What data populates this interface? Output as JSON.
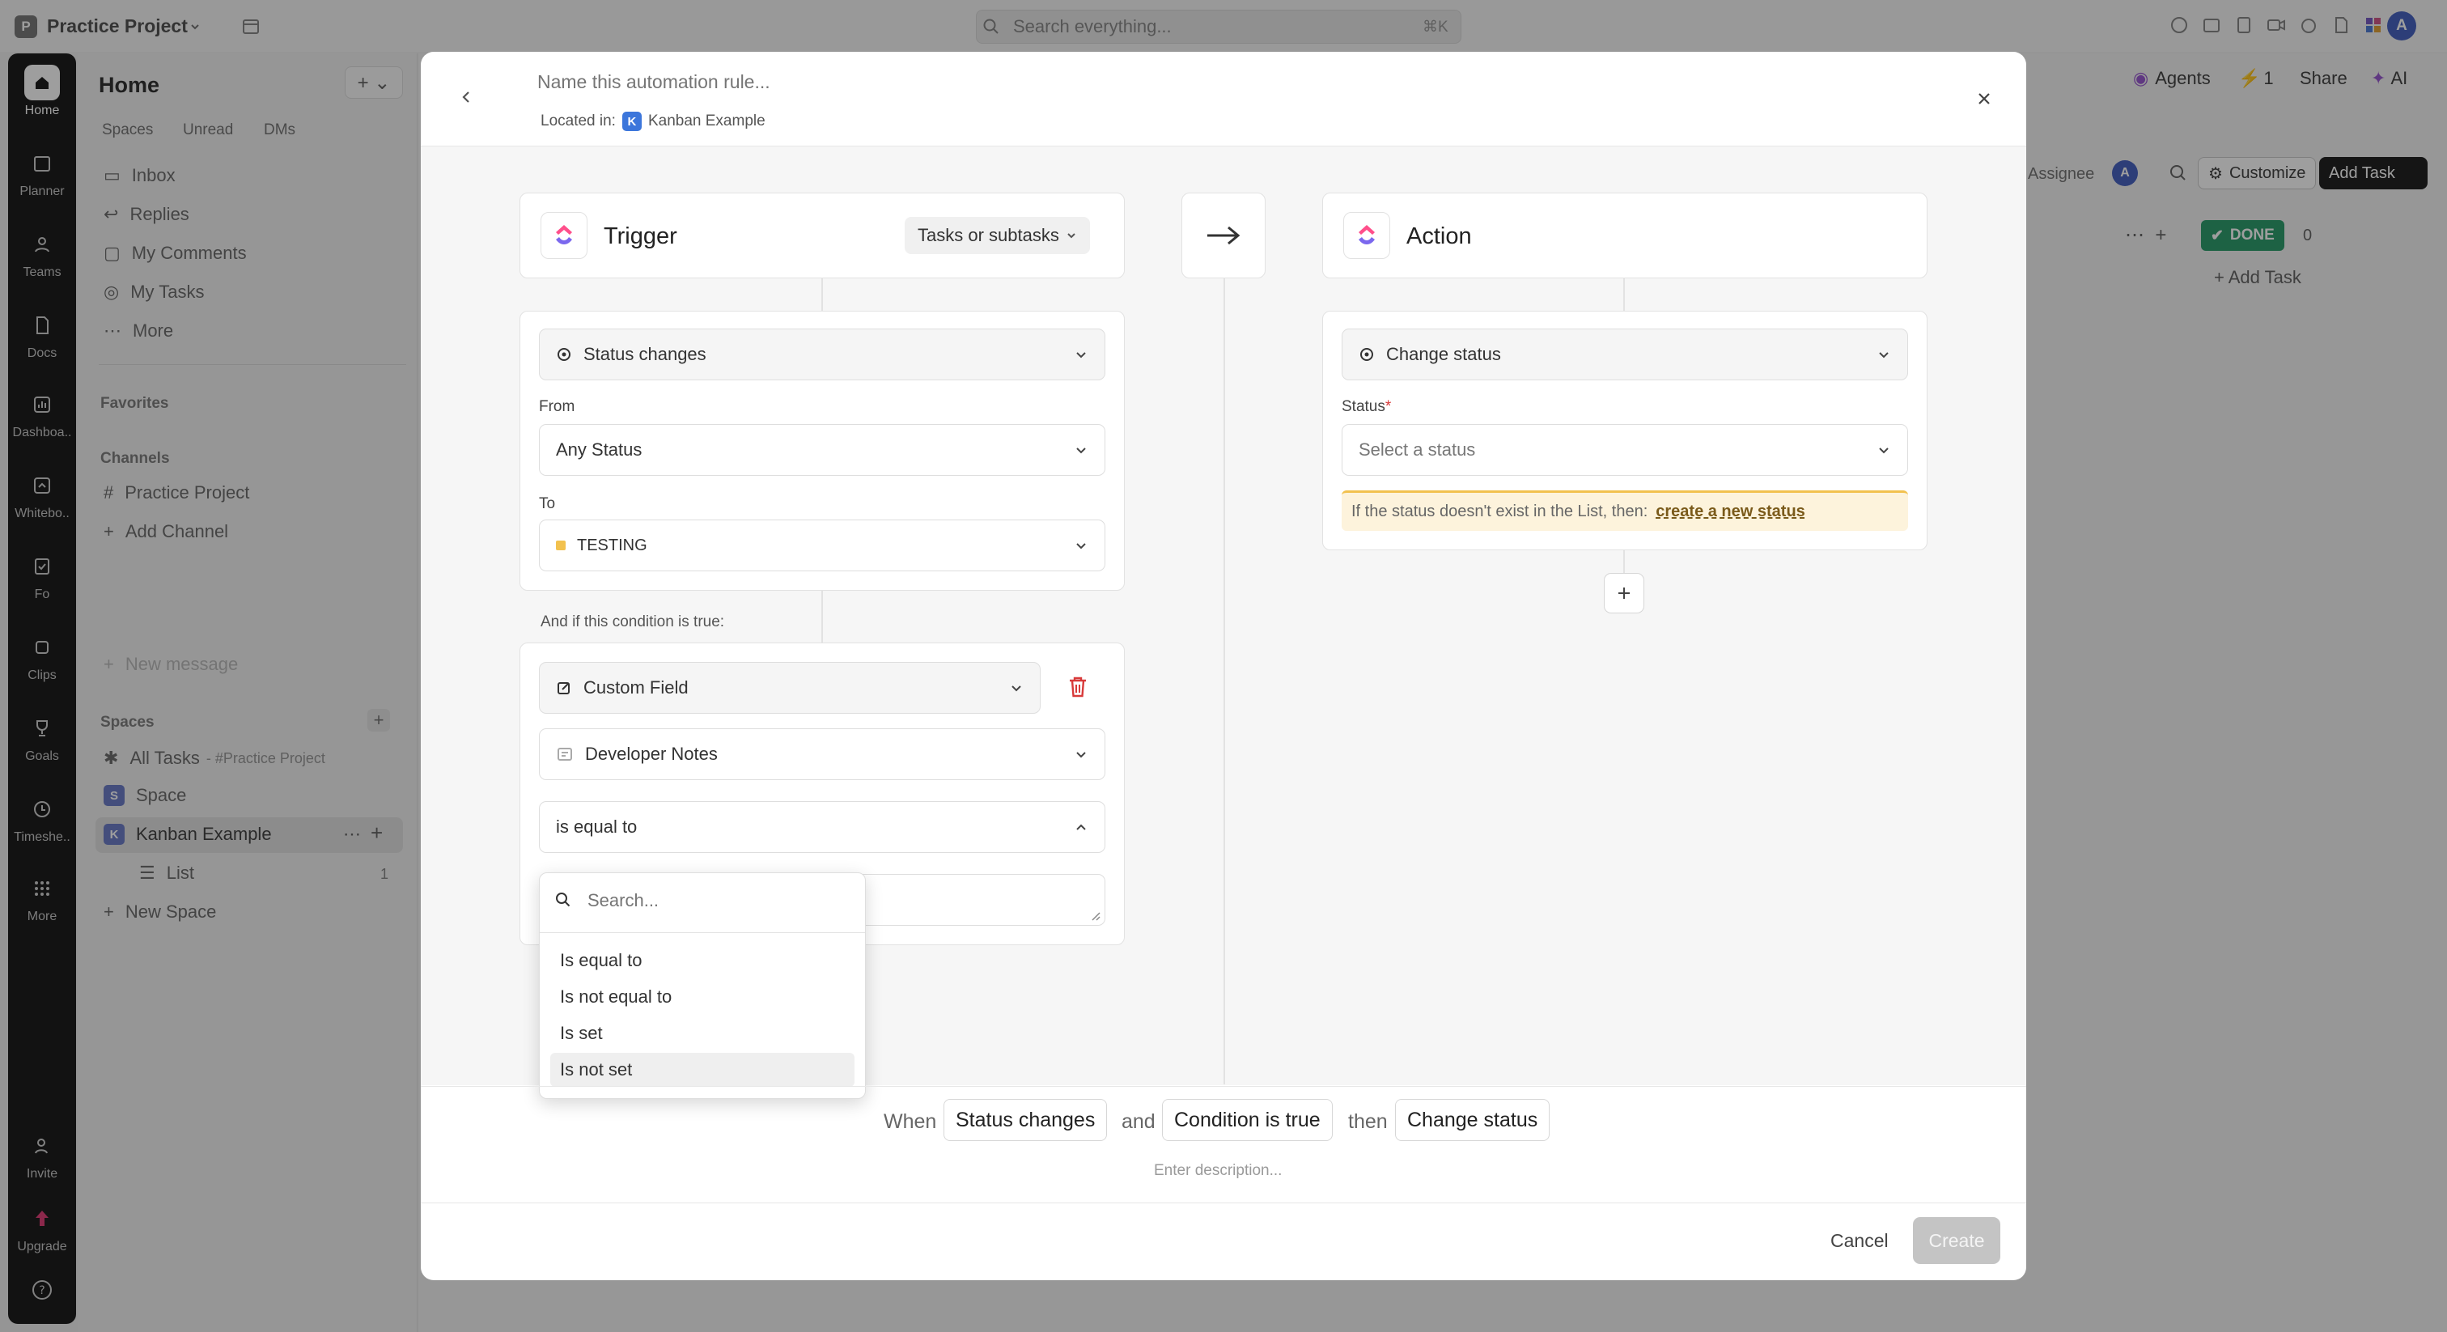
{
  "app": {
    "workspace_initial": "P",
    "workspace_name": "Practice Project",
    "search_placeholder": "Search everything...",
    "search_shortcut": "⌘K",
    "user_initial": "A"
  },
  "rail": {
    "items": [
      {
        "label": "Home",
        "icon": "home-icon"
      },
      {
        "label": "Planner",
        "icon": "calendar-icon"
      },
      {
        "label": "Teams",
        "icon": "teams-icon"
      },
      {
        "label": "Docs",
        "icon": "doc-icon"
      },
      {
        "label": "Dashboa..",
        "icon": "dashboard-icon"
      },
      {
        "label": "Whitebo..",
        "icon": "whiteboard-icon"
      },
      {
        "label": "Fo",
        "icon": "forms-icon"
      },
      {
        "label": "Clips",
        "icon": "clips-icon"
      },
      {
        "label": "Goals",
        "icon": "trophy-icon"
      },
      {
        "label": "Timeshe..",
        "icon": "clock-icon"
      },
      {
        "label": "More",
        "icon": "grid-icon"
      }
    ],
    "invite": "Invite",
    "upgrade": "Upgrade"
  },
  "sidebar": {
    "title": "Home",
    "tabs": [
      "Spaces",
      "Unread",
      "DMs"
    ],
    "nav": [
      "Inbox",
      "Replies",
      "My Comments",
      "My Tasks",
      "More"
    ],
    "favorites": "Favorites",
    "channels_label": "Channels",
    "channels": [
      "Practice Project"
    ],
    "add_channel": "Add Channel",
    "new_message": "New message",
    "spaces_label": "Spaces",
    "all_tasks": "All Tasks",
    "all_tasks_suffix": "- #Practice Project",
    "space": "Space",
    "space_initial": "S",
    "kanban": "Kanban Example",
    "kanban_initial": "K",
    "list": "List",
    "list_count": "1",
    "new_space": "New Space"
  },
  "background": {
    "agents": "Agents",
    "alerts": "1",
    "share": "Share",
    "ai": "AI",
    "assignee": "Assignee",
    "assignee_initial": "A",
    "customize": "Customize",
    "add_task_btn": "Add Task",
    "done_status": "DONE",
    "done_count": "0",
    "add_task_link": "+ Add Task"
  },
  "modal": {
    "name_placeholder": "Name this automation rule...",
    "located_in": "Located in:",
    "location_initial": "K",
    "location": "Kanban Example",
    "trigger": {
      "title": "Trigger",
      "scope": "Tasks or subtasks",
      "event": "Status changes",
      "from_label": "From",
      "from_value": "Any Status",
      "to_label": "To",
      "to_value": "TESTING",
      "condition_label": "And if this condition is true:",
      "condition_type": "Custom Field",
      "condition_field": "Developer Notes",
      "condition_operator": "is equal to"
    },
    "action": {
      "title": "Action",
      "event": "Change status",
      "status_label": "Status",
      "required_mark": "*",
      "status_placeholder": "Select a status",
      "notice": "If the status doesn't exist in the List, then:",
      "notice_link": "create a new status"
    },
    "dropdown": {
      "search_placeholder": "Search...",
      "options": [
        "Is equal to",
        "Is not equal to",
        "Is set",
        "Is not set"
      ],
      "highlighted_index": 3
    },
    "summary": {
      "when": "When",
      "trigger": "Status changes",
      "and": "and",
      "condition": "Condition is true",
      "then": "then",
      "action": "Change status"
    },
    "description_placeholder": "Enter description...",
    "cancel": "Cancel",
    "create": "Create"
  },
  "colors": {
    "testing_status": "#f2c14e",
    "notice_bg": "#fdf3dc",
    "notice_border": "#f2c14e",
    "delete": "#d83a3a",
    "done_badge": "#2f9e6e"
  }
}
